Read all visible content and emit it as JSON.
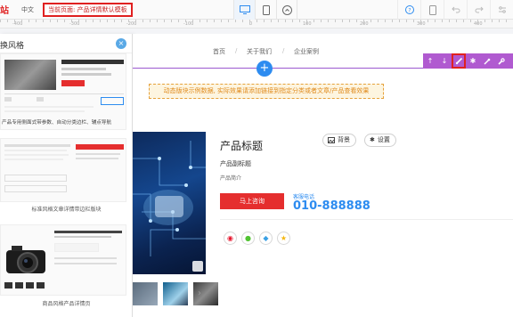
{
  "topbar": {
    "logo_text": "站",
    "language": "中文",
    "current_page": "当前页面: 产品详情默认模板",
    "devices": [
      "desktop-icon",
      "mobile-icon",
      "mini-program-icon"
    ],
    "right_icons": [
      "help-icon",
      "preview-icon",
      "undo-icon",
      "redo-icon",
      "settings-icon"
    ]
  },
  "ruler": {
    "labels": [
      "-400",
      "-300",
      "-200",
      "-100",
      "0",
      "100",
      "200",
      "300",
      "400"
    ]
  },
  "panel": {
    "title": "换风格",
    "style_cards": [
      {
        "caption": "",
        "desc": "产品专用侧面式带参数、自动分类边栏、辅点导航"
      },
      {
        "caption": "标准风格文章详情带边栏版块"
      },
      {
        "caption": "商品风格产品详情页"
      }
    ]
  },
  "canvas": {
    "nav": [
      "首页",
      "关于我们",
      "企业案例"
    ],
    "notice": "动态版块示例数据, 实际效果请添加链接到指定分类或者文章/产品查看效果",
    "module_toolbar": [
      "arrow-up-icon",
      "arrow-down-icon",
      "brush-icon",
      "gear-icon",
      "pin-icon",
      "wrench-icon"
    ],
    "product": {
      "title": "产品标题",
      "subtitle": "产品副标题",
      "intro": "产品简介",
      "bg_button": "背景",
      "settings_button": "设置",
      "consult_button": "马上咨询",
      "phone_label": "客服电话",
      "phone": "010-888888"
    },
    "share_icons": [
      "weibo-icon",
      "wechat-icon",
      "qq-icon",
      "qzone-icon"
    ]
  },
  "colors": {
    "accent_blue": "#2d8cf0",
    "toolbar_purple": "#b05ad0",
    "highlight_red": "#e02020",
    "consult_red": "#e52e2e"
  }
}
